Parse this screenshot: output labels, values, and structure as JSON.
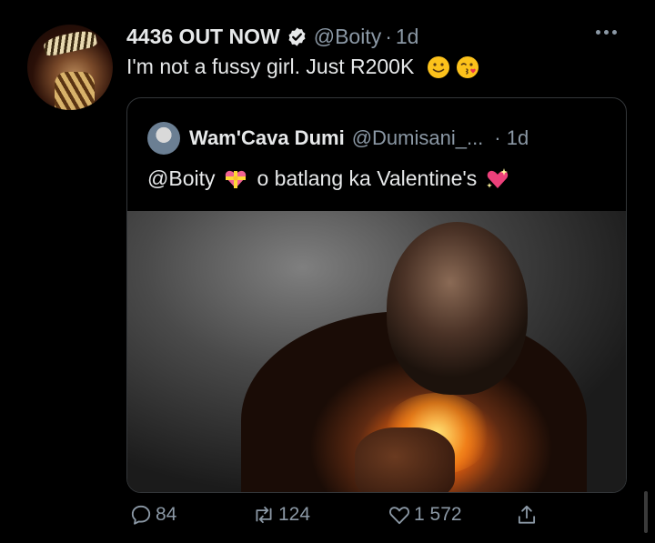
{
  "tweet": {
    "display_name": "4436 OUT NOW",
    "handle": "@Boity",
    "separator": "·",
    "time": "1d",
    "text": "I'm not a fussy girl. Just R200K"
  },
  "quote": {
    "display_name": "Wam'Cava Dumi",
    "handle": "@Dumisani_...",
    "time": "· 1d",
    "mention": "@Boity",
    "text": "o batlang ka Valentine's"
  },
  "actions": {
    "replies": "84",
    "retweets": "124",
    "likes": "1 572"
  },
  "icons": {
    "verified": "verified-badge-icon",
    "more": "more-options-icon",
    "reply": "reply-icon",
    "retweet": "retweet-icon",
    "like": "heart-icon",
    "share": "share-icon",
    "emojis": [
      "slightly-smiling-face",
      "face-blowing-kiss",
      "heart-with-ribbon",
      "sparkling-heart"
    ]
  },
  "colors": {
    "background": "#000000",
    "text": "#e7e9ea",
    "secondary_text": "#8b98a5",
    "border": "#333639"
  }
}
